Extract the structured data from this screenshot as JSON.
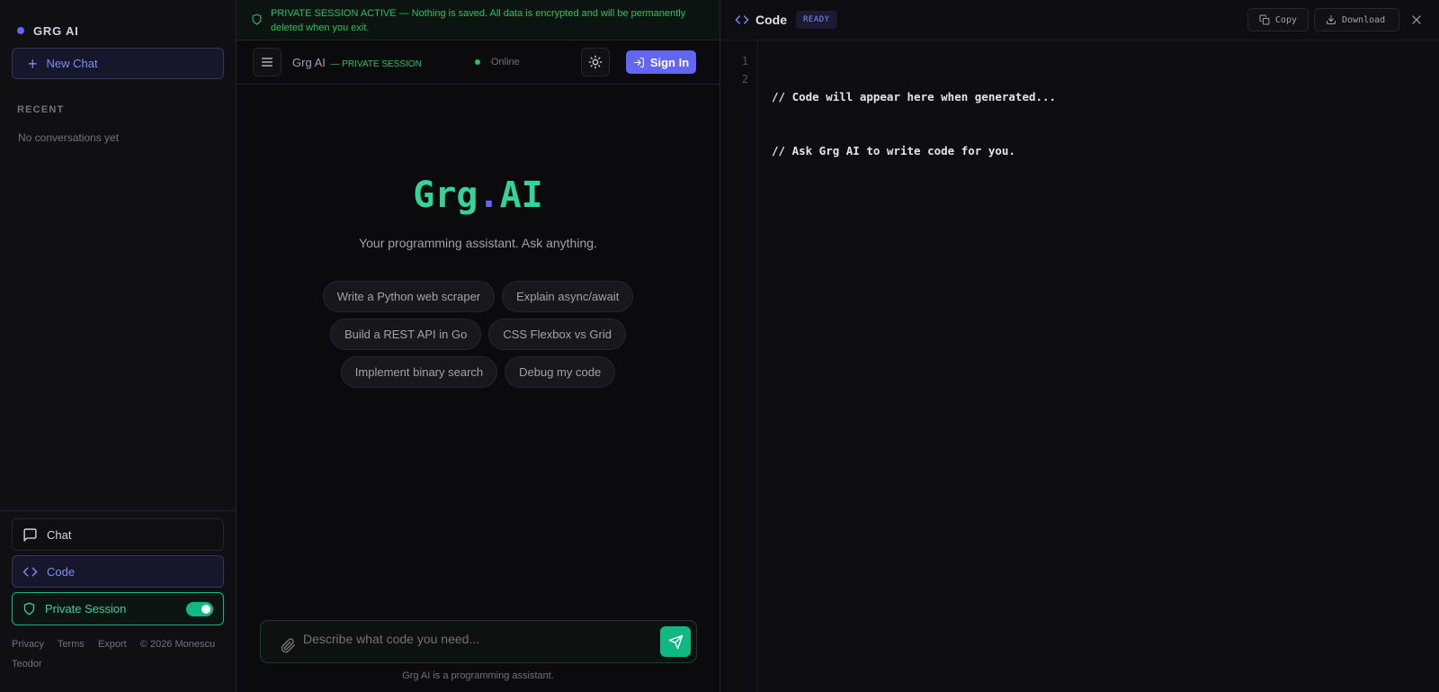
{
  "sidebar": {
    "brand": "GRG AI",
    "new_chat": "New Chat",
    "recent_label": "RECENT",
    "empty_label": "No conversations yet",
    "nav": {
      "chat": "Chat",
      "code": "Code",
      "private_session": "Private Session",
      "private_session_on": true
    },
    "footer": {
      "privacy": "Privacy",
      "terms": "Terms",
      "export": "Export",
      "copyright": "© 2026 Monescu Teodor"
    }
  },
  "main": {
    "banner": "PRIVATE SESSION ACTIVE — Nothing is saved. All data is encrypted and will be permanently deleted when you exit.",
    "topbar": {
      "title": "Grg AI",
      "subtitle": "— PRIVATE SESSION",
      "status": "Online",
      "sign_in": "Sign In"
    },
    "hero": {
      "title_a": "Grg",
      "title_dot": ".",
      "title_b": "AI",
      "subtitle": "Your programming assistant. Ask anything."
    },
    "suggestions": [
      [
        "Write a Python web scraper",
        "Explain async/await"
      ],
      [
        "Build a REST API in Go",
        "CSS Flexbox vs Grid"
      ],
      [
        "Implement binary search",
        "Debug my code"
      ]
    ],
    "composer": {
      "placeholder": "Describe what code you need...",
      "value": ""
    },
    "disclaimer": "Grg AI is a programming assistant."
  },
  "code_panel": {
    "title": "Code",
    "status": "READY",
    "copy": "Copy",
    "download": "Download",
    "line_numbers": [
      "1",
      "2"
    ],
    "lines": [
      "// Code will appear here when generated...",
      "// Ask Grg AI to write code for you."
    ]
  },
  "colors": {
    "accent": "#6366f1",
    "success": "#10b981",
    "brand_green": "#34d399"
  }
}
